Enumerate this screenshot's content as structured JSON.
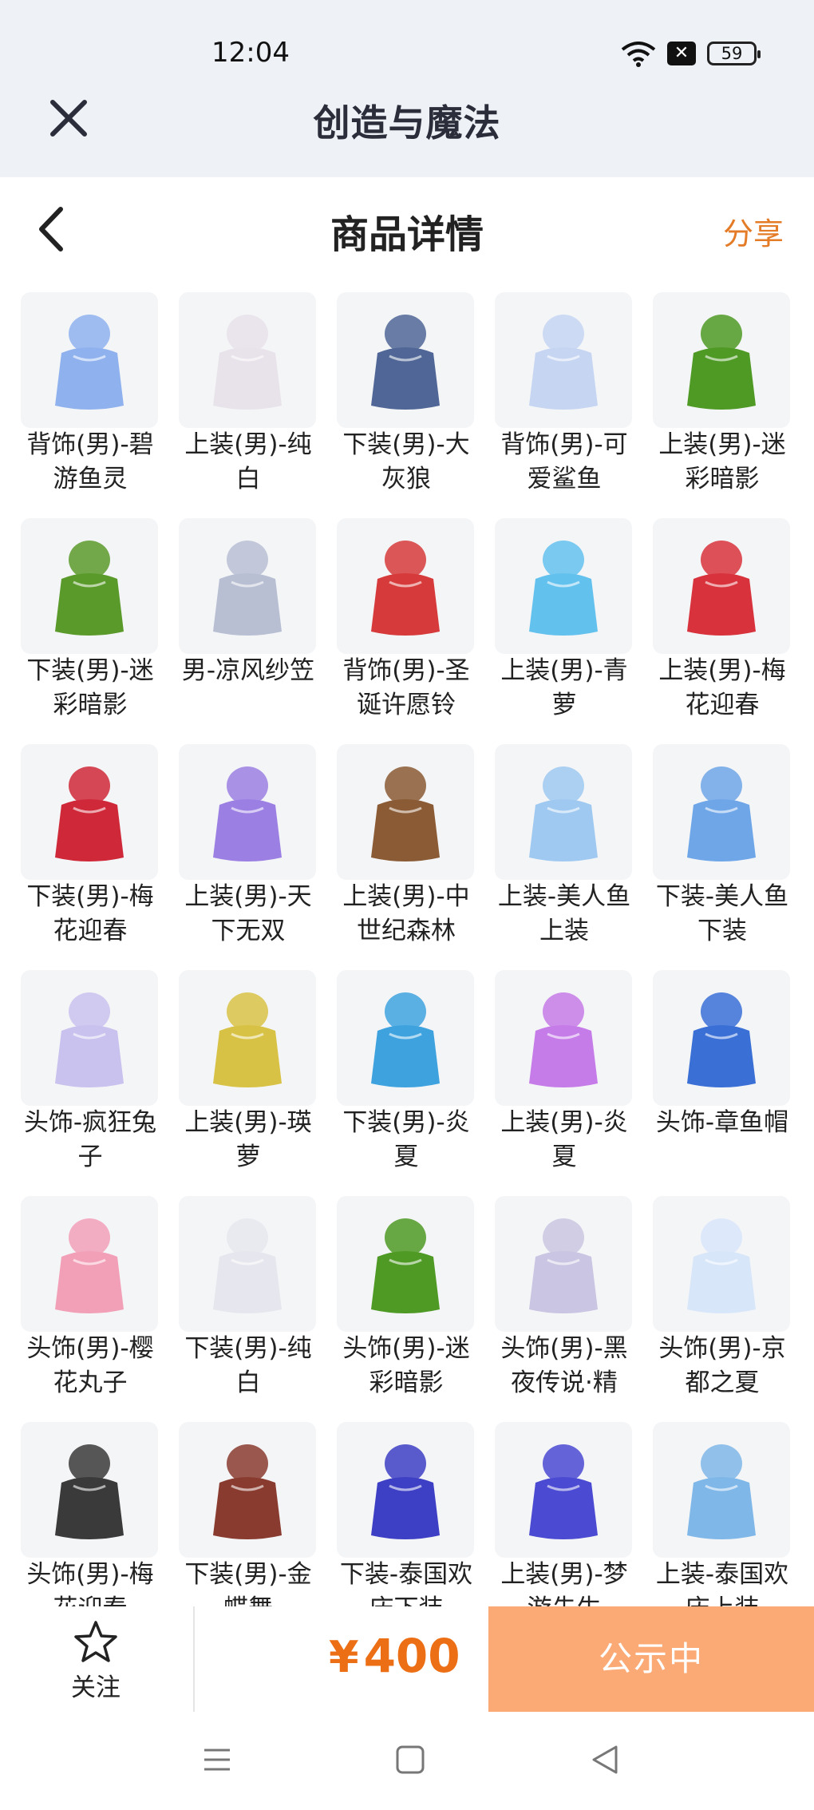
{
  "status_bar": {
    "time": "12:04",
    "battery": "59"
  },
  "app": {
    "title": "创造与魔法"
  },
  "header": {
    "title": "商品详情",
    "share_label": "分享"
  },
  "items": [
    {
      "label": "背饰(男)-碧游鱼灵",
      "color": "#8fb2ef"
    },
    {
      "label": "上装(男)-纯白",
      "color": "#e8e2ea"
    },
    {
      "label": "下装(男)-大灰狼",
      "color": "#4f6696"
    },
    {
      "label": "背饰(男)-可爱鲨鱼",
      "color": "#c5d5f2"
    },
    {
      "label": "上装(男)-迷彩暗影",
      "color": "#4f9a25"
    },
    {
      "label": "下装(男)-迷彩暗影",
      "color": "#5a9a2a"
    },
    {
      "label": "男-凉风纱笠",
      "color": "#b8bfd3"
    },
    {
      "label": "背饰(男)-圣诞许愿铃",
      "color": "#d63a3a"
    },
    {
      "label": "上装(男)-青萝",
      "color": "#63c1ee"
    },
    {
      "label": "上装(男)-梅花迎春",
      "color": "#d8333c"
    },
    {
      "label": "下装(男)-梅花迎春",
      "color": "#cf2838"
    },
    {
      "label": "上装(男)-天下无双",
      "color": "#9b7fe3"
    },
    {
      "label": "上装(男)-中世纪森林",
      "color": "#8a5b34"
    },
    {
      "label": "上装-美人鱼上装",
      "color": "#9fc9f1"
    },
    {
      "label": "下装-美人鱼下装",
      "color": "#6ea6e8"
    },
    {
      "label": "头饰-疯狂兔子",
      "color": "#c9c1ee"
    },
    {
      "label": "上装(男)-瑛萝",
      "color": "#d8c245"
    },
    {
      "label": "下装(男)-炎夏",
      "color": "#3ea2df"
    },
    {
      "label": "上装(男)-炎夏",
      "color": "#c57be8"
    },
    {
      "label": "头饰-章鱼帽",
      "color": "#3a6fd6"
    },
    {
      "label": "头饰(男)-樱花丸子",
      "color": "#f2a0b8"
    },
    {
      "label": "下装(男)-纯白",
      "color": "#e6e6ee"
    },
    {
      "label": "头饰(男)-迷彩暗影",
      "color": "#4f9a25"
    },
    {
      "label": "头饰(男)-黑夜传说·精",
      "color": "#c9c5e2"
    },
    {
      "label": "头饰(男)-京都之夏",
      "color": "#d8e6fa"
    },
    {
      "label": "头饰(男)-梅花迎春",
      "color": "#3a3a3a"
    },
    {
      "label": "下装(男)-金蝶舞",
      "color": "#8a3b2f"
    },
    {
      "label": "下装-泰国欢庆下装",
      "color": "#3d3fc4"
    },
    {
      "label": "上装(男)-梦游先生",
      "color": "#4a4ad2"
    },
    {
      "label": "上装-泰国欢庆上装",
      "color": "#7fb7e8"
    }
  ],
  "bottom": {
    "follow_label": "关注",
    "currency": "¥",
    "price": "400",
    "status_label": "公示中"
  }
}
